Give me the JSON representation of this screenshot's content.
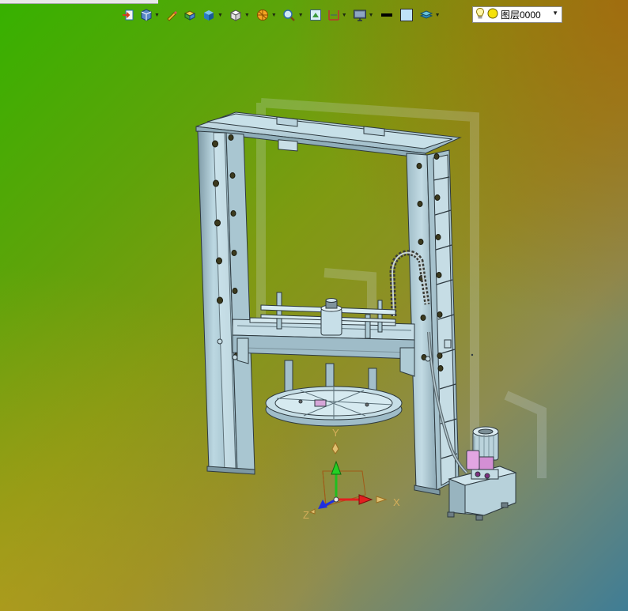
{
  "toolbar": {
    "items": [
      {
        "name": "exit-sketch-icon"
      },
      {
        "name": "view-orientation-icon"
      },
      {
        "name": "pencil-icon"
      },
      {
        "name": "render-style-icon"
      },
      {
        "name": "shaded-cube-icon"
      },
      {
        "name": "wireframe-cube-icon"
      },
      {
        "name": "section-view-icon"
      },
      {
        "name": "zoom-icon"
      },
      {
        "name": "fit-view-icon"
      },
      {
        "name": "dimension-icon"
      },
      {
        "name": "display-monitor-icon"
      },
      {
        "name": "line-color-swatch"
      },
      {
        "name": "fill-color-swatch"
      },
      {
        "name": "layer-stack-icon"
      }
    ],
    "layer": {
      "value": "图层0000",
      "bulb_icon": "lightbulb-icon",
      "color_icon": "yellow-dot-icon"
    }
  },
  "triad": {
    "x_label": "X",
    "y_label": "Y",
    "z_label": "Z",
    "x_color": "#e02020",
    "y_color": "#20c020",
    "z_color": "#2030e0"
  },
  "colors": {
    "part": "#b6d4de",
    "edge": "#2e3a40",
    "accent_layer_box": "#ffffff"
  }
}
